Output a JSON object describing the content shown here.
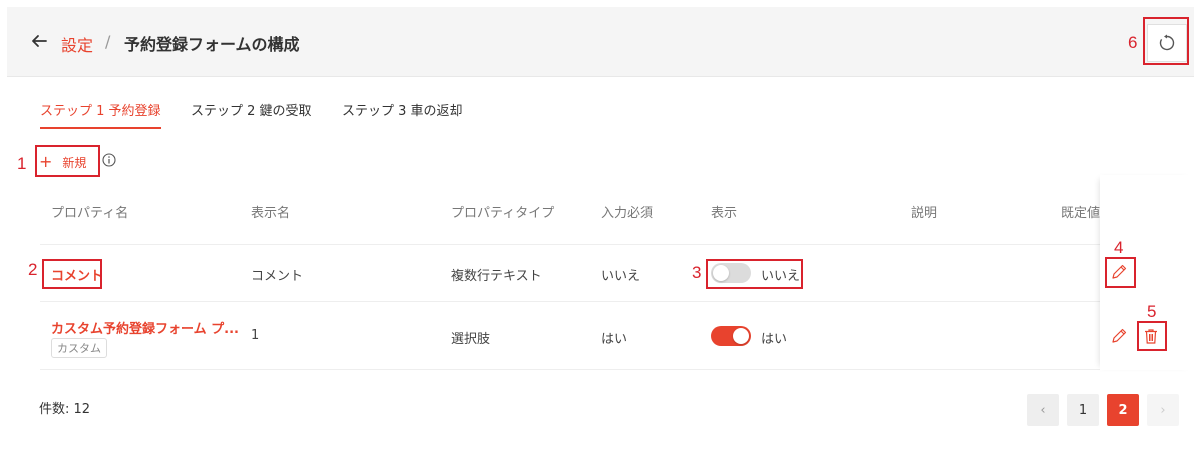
{
  "breadcrumb": {
    "parent": "設定",
    "separator": "/",
    "current": "予約登録フォームの構成"
  },
  "tabs": [
    {
      "label": "ステップ 1 予約登録",
      "active": true
    },
    {
      "label": "ステップ 2 鍵の受取",
      "active": false
    },
    {
      "label": "ステップ 3 車の返却",
      "active": false
    }
  ],
  "toolbar": {
    "new_label": "新規",
    "new_symbol": "+"
  },
  "table": {
    "headers": [
      "プロパティ名",
      "表示名",
      "プロパティタイプ",
      "入力必須",
      "表示",
      "説明",
      "既定値"
    ],
    "rows": [
      {
        "property": "コメント",
        "display_name": "コメント",
        "type": "複数行テキスト",
        "required": "いいえ",
        "visible_label": "いいえ",
        "visible": false,
        "tag": ""
      },
      {
        "property": "カスタム予約登録フォーム プ...",
        "display_name": "1",
        "type": "選択肢",
        "required": "はい",
        "visible_label": "はい",
        "visible": true,
        "tag": "カスタム"
      }
    ]
  },
  "footer": {
    "count_label": "件数: 12"
  },
  "pagination": {
    "prev": "‹",
    "next": "›",
    "pages": [
      "1",
      "2"
    ],
    "current": "2"
  },
  "annotations": [
    "1",
    "2",
    "3",
    "4",
    "5",
    "6"
  ],
  "colors": {
    "accent": "#e8432e",
    "annotation": "#d9232d"
  }
}
